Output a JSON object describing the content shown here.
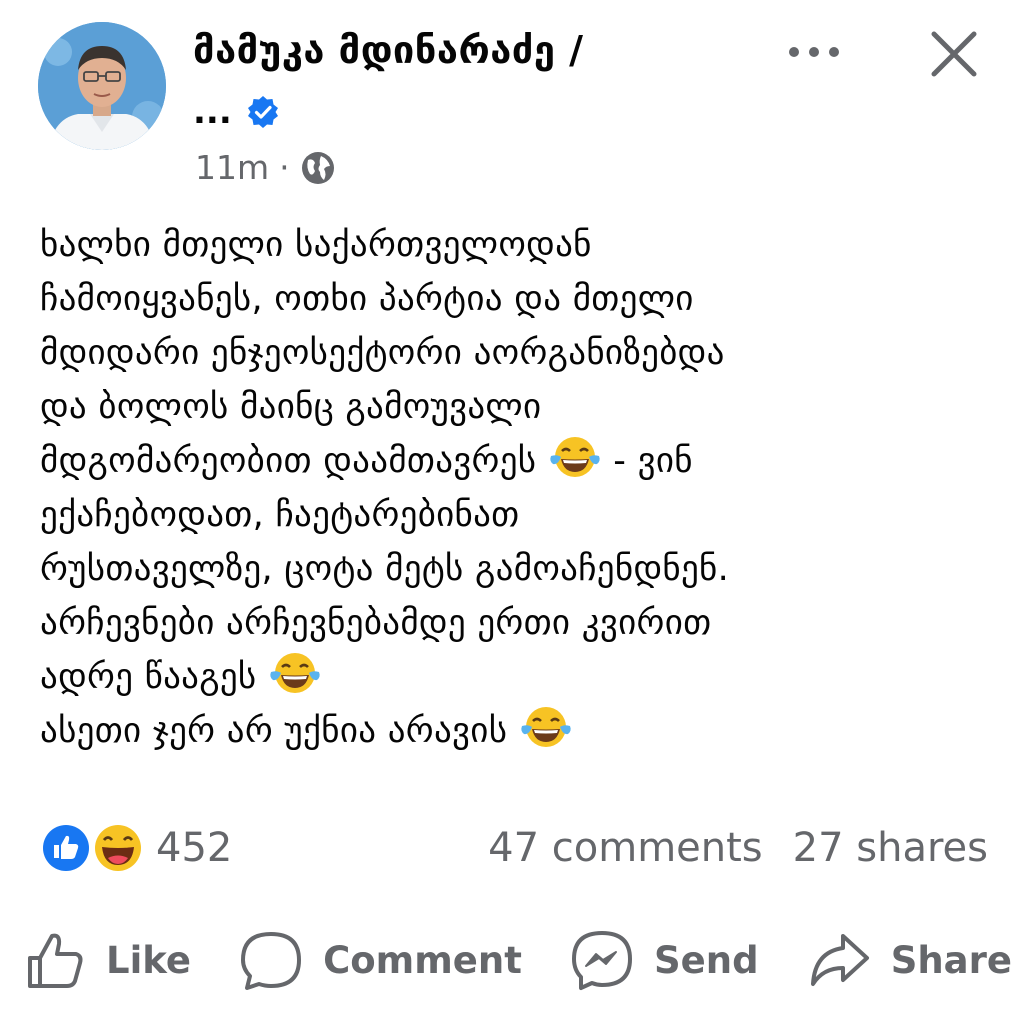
{
  "post": {
    "author_name": "მამუკა მდინარაძე /",
    "author_name_cont": "...",
    "time": "11m",
    "separator": "·",
    "lines": [
      "ხალხი მთელი საქართველოდან",
      "ჩამოიყვანეს, ოთხი პარტია და მთელი",
      "მდიდარი ენჯეოსექტორი აორგანიზებდა",
      "და ბოლოს მაინც გამოუვალი",
      "მდგომარეობით დაამთავრეს",
      "- ვინ",
      "ექაჩებოდათ, ჩაეტარებინათ",
      "რუსთაველზე, ცოტა მეტს გამოაჩენდნენ.",
      "არჩევნები არჩევნებამდე ერთი კვირით",
      "ადრე წააგეს",
      "ასეთი ჯერ არ უქნია არავის"
    ]
  },
  "engagement": {
    "reaction_count": "452",
    "comments": "47 comments",
    "shares": "27 shares"
  },
  "actions": {
    "like": "Like",
    "comment": "Comment",
    "send": "Send",
    "share": "Share"
  },
  "icons": {
    "verified": "verified-badge-icon",
    "audience": "globe-icon",
    "more": "more-options-icon",
    "close": "close-icon",
    "emoji": "tears-of-joy-emoji"
  },
  "colors": {
    "text": "#050505",
    "secondary": "#65676b",
    "like_blue": "#1877f2"
  }
}
